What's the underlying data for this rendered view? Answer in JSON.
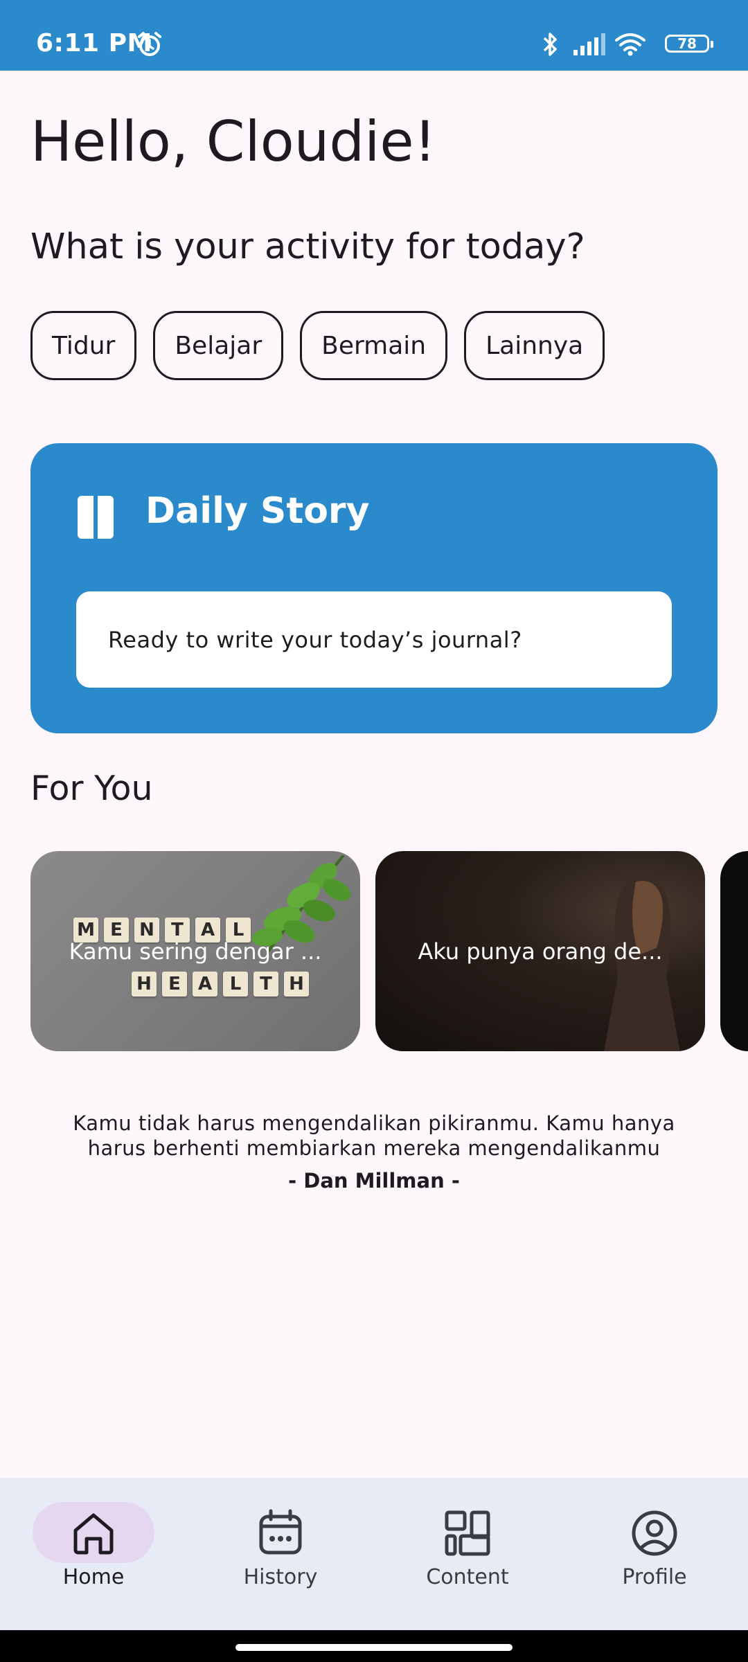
{
  "status": {
    "time": "6:11 PM",
    "battery": "78",
    "icons": [
      "alarm-icon",
      "bluetooth-icon",
      "signal-icon",
      "wifi-icon",
      "battery-icon"
    ]
  },
  "greeting": "Hello, Cloudie!",
  "activity_prompt": "What is your activity for today?",
  "activities": [
    "Tidur",
    "Belajar",
    "Bermain",
    "Lainnya"
  ],
  "daily_story": {
    "title": "Daily Story",
    "icon": "book-icon",
    "prompt": "Ready to write your today’s journal?"
  },
  "for_you": {
    "title": "For You",
    "cards": [
      {
        "title": "Kamu sering dengar ..."
      },
      {
        "title": "Aku punya orang de..."
      }
    ],
    "card1_tiles": {
      "row1": [
        "M",
        "E",
        "N",
        "T",
        "A",
        "L"
      ],
      "row2": [
        "H",
        "E",
        "A",
        "L",
        "T",
        "H"
      ]
    }
  },
  "quote": {
    "text": "Kamu tidak harus mengendalikan pikiranmu. Kamu hanya harus berhenti membiarkan mereka mengendalikanmu",
    "author": "- Dan Millman -"
  },
  "nav": {
    "items": [
      {
        "label": "Home",
        "icon": "home-icon",
        "active": true
      },
      {
        "label": "History",
        "icon": "calendar-icon",
        "active": false
      },
      {
        "label": "Content",
        "icon": "dashboard-icon",
        "active": false
      },
      {
        "label": "Profile",
        "icon": "profile-icon",
        "active": false
      }
    ]
  },
  "colors": {
    "primary": "#2a8acb",
    "background": "#fdf7fb",
    "nav_background": "#e7ebf5",
    "nav_active_pill": "#e6d7f1"
  }
}
